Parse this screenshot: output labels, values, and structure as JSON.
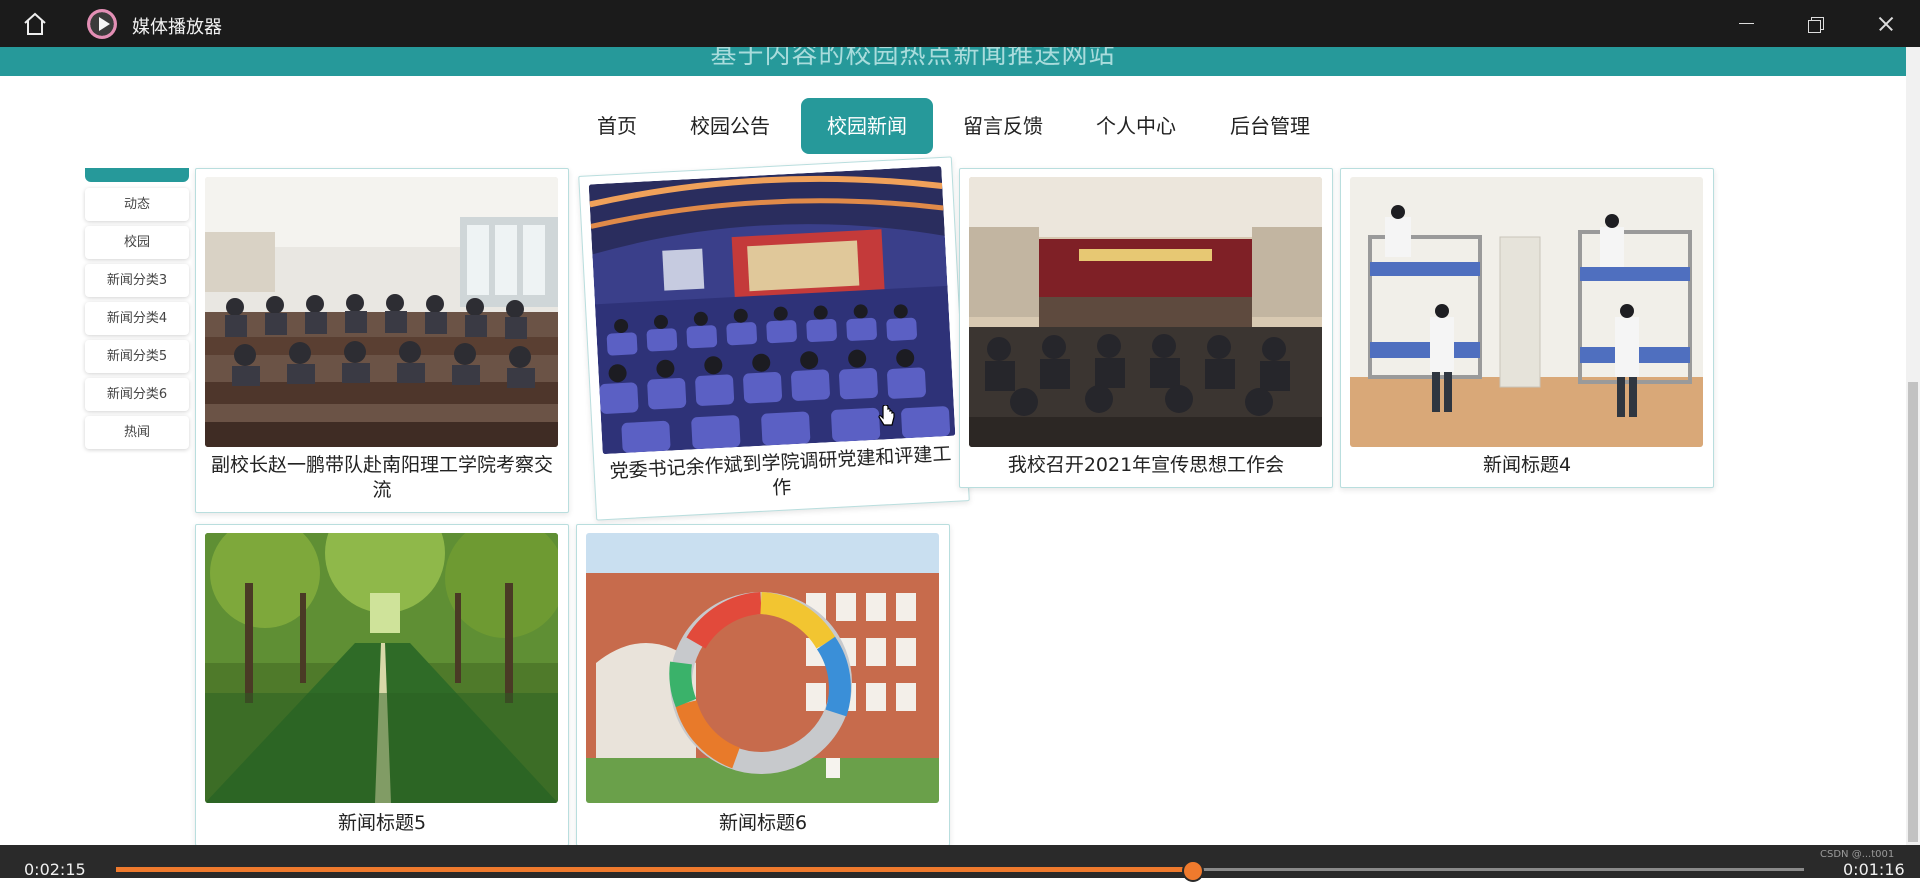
{
  "player": {
    "title": "媒体播放器",
    "time_elapsed": "0:02:15",
    "time_remaining": "0:01:16",
    "progress_fraction": 0.638,
    "watermark": "CSDN @...t001",
    "accent_color": "#ef7a2d"
  },
  "site": {
    "title": "基于内容的校园热点新闻推送网站",
    "brand_color": "#26999a"
  },
  "nav": {
    "items": [
      {
        "label": "首页"
      },
      {
        "label": "校园公告"
      },
      {
        "label": "校园新闻",
        "active": true
      },
      {
        "label": "留言反馈"
      },
      {
        "label": "个人中心"
      },
      {
        "label": "后台管理"
      }
    ]
  },
  "sidebar": {
    "items": [
      {
        "label": "动态"
      },
      {
        "label": "校园"
      },
      {
        "label": "新闻分类3"
      },
      {
        "label": "新闻分类4"
      },
      {
        "label": "新闻分类5"
      },
      {
        "label": "新闻分类6"
      },
      {
        "label": "热闻"
      }
    ]
  },
  "news": {
    "cards": [
      {
        "title": "副校长赵一鹏带队赴南阳理工学院考察交流",
        "image": "conference-room-photo"
      },
      {
        "title": "党委书记余作斌到学院调研党建和评建工作",
        "image": "auditorium-photo"
      },
      {
        "title": "我校召开2021年宣传思想工作会",
        "image": "meeting-hall-photo"
      },
      {
        "title": "新闻标题4",
        "image": "dormitory-photo"
      },
      {
        "title": "新闻标题5",
        "image": "tree-path-photo"
      },
      {
        "title": "新闻标题6",
        "image": "campus-sculpture-photo"
      }
    ]
  }
}
